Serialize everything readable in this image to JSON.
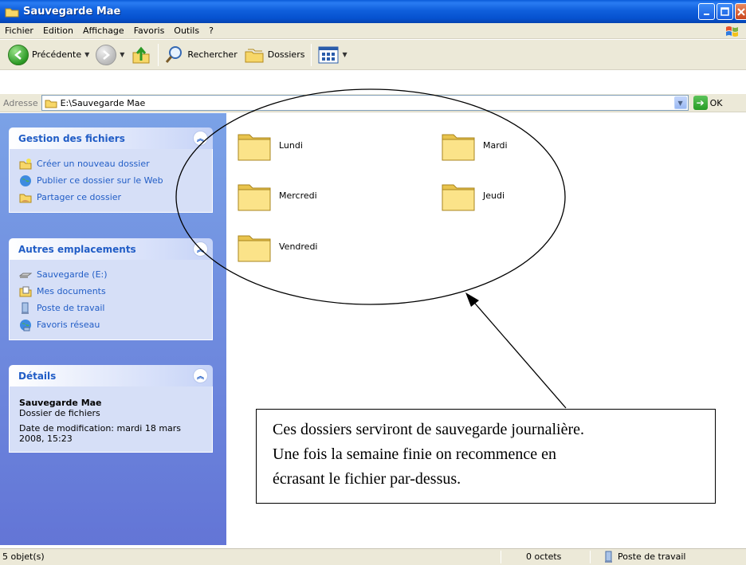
{
  "window": {
    "title": "Sauvegarde Mae"
  },
  "menu": [
    "Fichier",
    "Edition",
    "Affichage",
    "Favoris",
    "Outils",
    "?"
  ],
  "toolbar": {
    "back_label": "Précédente",
    "search_label": "Rechercher",
    "folders_label": "Dossiers"
  },
  "address": {
    "label": "Adresse",
    "value": "E:\\Sauvegarde Mae",
    "go_label": "OK"
  },
  "taskpane": {
    "file_tasks": {
      "title": "Gestion des fichiers",
      "items": [
        "Créer un nouveau dossier",
        "Publier ce dossier sur le Web",
        "Partager ce dossier"
      ]
    },
    "other_places": {
      "title": "Autres emplacements",
      "items": [
        "Sauvegarde (E:)",
        "Mes documents",
        "Poste de travail",
        "Favoris réseau"
      ]
    },
    "details": {
      "title": "Détails",
      "name": "Sauvegarde Mae",
      "type": "Dossier de fichiers",
      "modified": "Date de modification: mardi 18 mars 2008, 15:23"
    }
  },
  "folders": [
    "Lundi",
    "Mardi",
    "Mercredi",
    "Jeudi",
    "Vendredi"
  ],
  "annotation": {
    "lines": [
      "Ces dossiers serviront de sauvegarde journalière.",
      "Une fois la semaine finie on recommence en",
      "écrasant le fichier par-dessus."
    ]
  },
  "status": {
    "objects": "5 objet(s)",
    "size": "0 octets",
    "location": "Poste de travail"
  },
  "colors": {
    "titlebar": "#0a5bd8",
    "taskpane": "#7ba2e7",
    "panel_text": "#215dc6",
    "chrome": "#ece9d8"
  }
}
